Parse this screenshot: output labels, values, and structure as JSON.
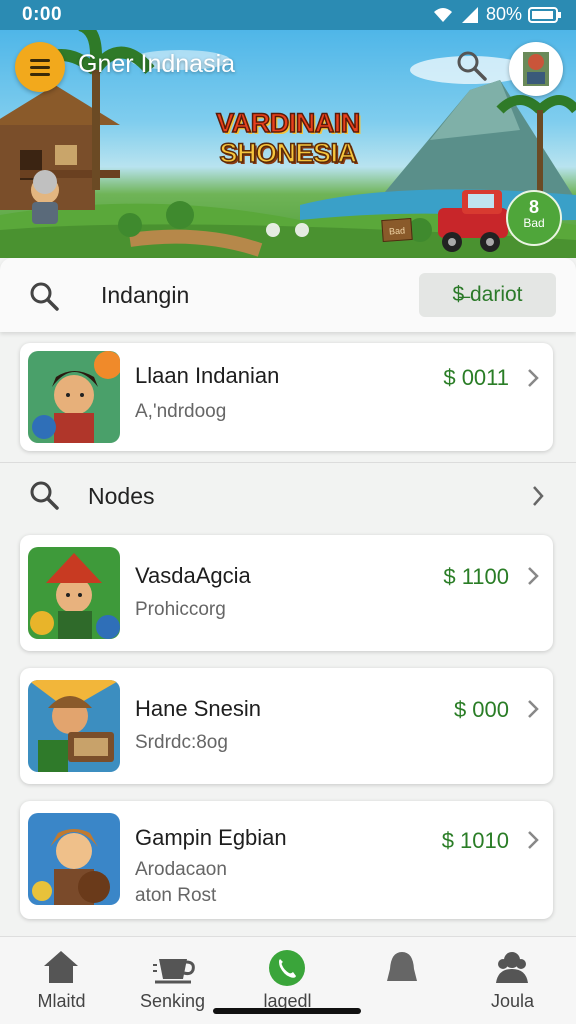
{
  "status_bar": {
    "time": "0:00",
    "battery": "80%"
  },
  "header": {
    "title": "Gner Indnasia",
    "game_logo_line1": "VARDINAIN",
    "game_logo_line2": "SHONESIA",
    "carousel_dots": 2,
    "promo_badge_number": "8",
    "promo_badge_text": "Bad",
    "sign_text": "Bad"
  },
  "search": {
    "value": "Indangin",
    "button_label": "$̶ dariot"
  },
  "featured": {
    "name": "Llaan Indanian",
    "subtitle": "A,'ndrdoog",
    "price": "$ 0011"
  },
  "section": {
    "label": "Nodes"
  },
  "items": [
    {
      "name": "VasdaAgcia",
      "subtitle": "Prohiccorg",
      "price": "$ 1100"
    },
    {
      "name": "Hane Snesin",
      "subtitle": "Srdrdc:8og",
      "price": "$  000"
    },
    {
      "name": "Gampin Egbian",
      "subtitle": "Arodacaon\naton Rost",
      "price": "$ 1010"
    }
  ],
  "bottom_nav": [
    {
      "label": "Mlaitd",
      "icon": "home-icon"
    },
    {
      "label": "Senking",
      "icon": "coffee-cup-icon"
    },
    {
      "label": "lagedl",
      "icon": "phone-icon",
      "active": true
    },
    {
      "label": "",
      "icon": "bell-icon"
    },
    {
      "label": "Joula",
      "icon": "profile-icon"
    }
  ],
  "colors": {
    "accent": "#f2a91c",
    "price_green": "#2a7d26",
    "status_bar": "#2b8bb3",
    "active_nav": "#3aa53a"
  }
}
